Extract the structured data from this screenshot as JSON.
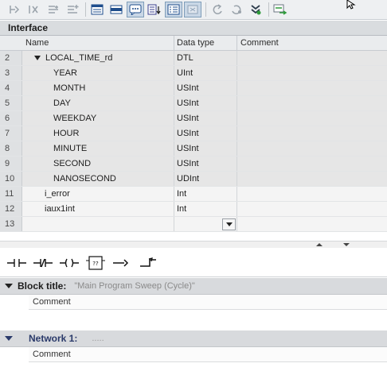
{
  "interface": {
    "title": "Interface",
    "columns": {
      "name": "Name",
      "data_type": "Data type",
      "comment": "Comment"
    },
    "rows": [
      {
        "num": "2",
        "name": "LOCAL_TIME_rd",
        "type": "DTL",
        "expanded": true,
        "level": 0
      },
      {
        "num": "3",
        "name": "YEAR",
        "type": "UInt",
        "level": 1
      },
      {
        "num": "4",
        "name": "MONTH",
        "type": "USInt",
        "level": 1
      },
      {
        "num": "5",
        "name": "DAY",
        "type": "USInt",
        "level": 1
      },
      {
        "num": "6",
        "name": "WEEKDAY",
        "type": "USInt",
        "level": 1
      },
      {
        "num": "7",
        "name": "HOUR",
        "type": "USInt",
        "level": 1
      },
      {
        "num": "8",
        "name": "MINUTE",
        "type": "USInt",
        "level": 1
      },
      {
        "num": "9",
        "name": "SECOND",
        "type": "USInt",
        "level": 1
      },
      {
        "num": "10",
        "name": "NANOSECOND",
        "type": "UDInt",
        "level": 1
      },
      {
        "num": "11",
        "name": "i_error",
        "type": "Int",
        "level": 0
      },
      {
        "num": "12",
        "name": "iaux1int",
        "type": "Int",
        "level": 0
      },
      {
        "num": "13",
        "name": "",
        "type": "",
        "level": 0
      }
    ]
  },
  "lad_instructions": [
    "normally-open-contact-icon",
    "normally-closed-contact-icon",
    "output-coil-icon",
    "empty-box-icon",
    "open-branch-icon",
    "close-branch-icon"
  ],
  "block": {
    "title_label": "Block title:",
    "title_value": "\"Main Program Sweep (Cycle)\"",
    "comment": "Comment"
  },
  "network": {
    "label": "Network 1:",
    "title_value": ".....",
    "comment": "Comment"
  },
  "colors": {
    "accent": "#2a3a6a",
    "active_tool": "#c9d7e6"
  }
}
